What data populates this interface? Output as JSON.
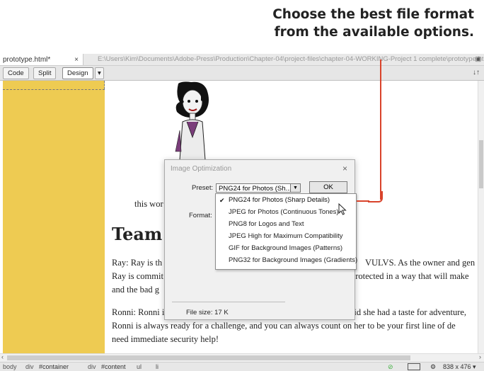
{
  "callout": {
    "line1": "Choose the best file format",
    "line2": "from the available options."
  },
  "tabbar": {
    "tab_label": "prototype.html*",
    "close_glyph": "×",
    "path": "E:\\Users\\Kim\\Documents\\Adobe-Press\\Production\\Chapter-04\\project-files\\chapter-04-WORKING-Project 1 complete\\prototype.html"
  },
  "toolbar": {
    "code": "Code",
    "split": "Split",
    "design": "Design",
    "menu": "▾",
    "sort": "↓↑"
  },
  "content": {
    "line1": "this wor",
    "heading": "Team I",
    "p1a": "Ray: Ray is th",
    "p1a_right": "VULVS. As the owner and gen",
    "p1b": "Ray is commit",
    "p1b_right": "protected in a way that will make",
    "p1c": "and the bad g",
    "p2a": "Ronni: Ronni i",
    "p2a_right": "said she had a taste for adventure,",
    "p2b": "Ronni is always ready for a challenge, and you can always count on her to be your first line of de",
    "p2c": "need immediate security help!"
  },
  "dialog": {
    "title": "Image Optimization",
    "close": "×",
    "preset_label": "Preset:",
    "preset_value": "PNG24 for Photos (Sh...",
    "ok": "OK",
    "format_label": "Format:",
    "file_size": "File size:  17 K"
  },
  "dropdown": {
    "items": [
      {
        "label": "PNG24 for Photos (Sharp Details)",
        "checked": "✔"
      },
      {
        "label": "JPEG for Photos (Continuous Tones)"
      },
      {
        "label": "PNG8 for Logos and Text"
      },
      {
        "label": "JPEG High for Maximum Compatibility"
      },
      {
        "label": "GIF for Background Images (Patterns)"
      },
      {
        "label": "PNG32 for Background Images (Gradients)"
      }
    ]
  },
  "statusbar": {
    "crumbs": [
      "body",
      "div",
      "#container",
      "div",
      "#content",
      "ul",
      "li"
    ],
    "size": "838 x 476 ▾"
  },
  "colors": {
    "accent": "#d9432b",
    "sidebar": "#eecb52"
  }
}
